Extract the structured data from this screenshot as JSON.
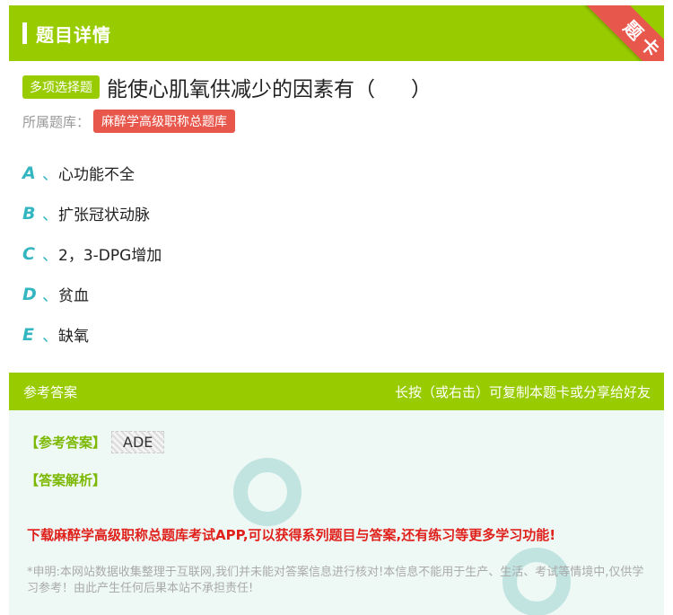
{
  "header": {
    "title": "题目详情",
    "ribbon": "题卡"
  },
  "question": {
    "type_tag": "多项选择题",
    "text": "能使心肌氧供减少的因素有（",
    "paren_close": "）",
    "bank_label": "所属题库：",
    "bank_name": "麻醉学高级职称总题库"
  },
  "options": [
    {
      "letter": "A",
      "sep": "、",
      "text": "心功能不全"
    },
    {
      "letter": "B",
      "sep": "、",
      "text": "扩张冠状动脉"
    },
    {
      "letter": "C",
      "sep": "、",
      "text": "2，3-DPG增加"
    },
    {
      "letter": "D",
      "sep": "、",
      "text": "贫血"
    },
    {
      "letter": "E",
      "sep": "、",
      "text": "缺氧"
    }
  ],
  "answer": {
    "header_left": "参考答案",
    "header_right": "长按（或右击）可复制本题卡或分享给好友",
    "answer_label": "【参考答案】",
    "answer_value": "ADE",
    "analysis_label": "【答案解析】",
    "download_text": "下载麻醉学高级职称总题库考试APP,可以获得系列题目与答案,还有练习等更多学习功能!",
    "disclaimer": "*申明:本网站数据收集整理于互联网,我们并未能对答案信息进行核对!本信息不能用于生产、生活、考试等情境中,仅供学习参考！由此产生任何后果本站不承担责任!"
  },
  "colors": {
    "accent_green": "#99cc00",
    "ribbon_red": "#e8574b",
    "option_teal": "#33b6c0",
    "download_red": "#e0201b"
  }
}
